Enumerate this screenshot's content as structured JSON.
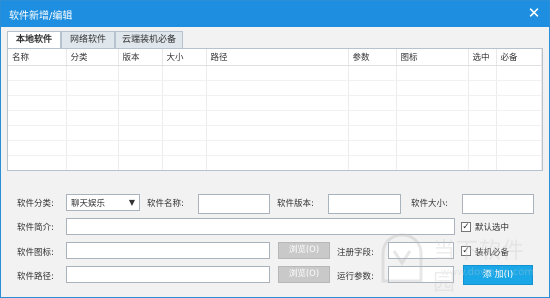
{
  "window": {
    "title": "软件新增/编辑"
  },
  "tabs": [
    {
      "label": "本地软件",
      "active": true
    },
    {
      "label": "网络软件",
      "active": false
    },
    {
      "label": "云端装机必备",
      "active": false
    }
  ],
  "table": {
    "columns": [
      "名称",
      "分类",
      "版本",
      "大小",
      "路径",
      "参数",
      "图标",
      "选中",
      "必备"
    ]
  },
  "form": {
    "category_label": "软件分类:",
    "category_value": "聊天娱乐",
    "name_label": "软件名称:",
    "name_value": "",
    "version_label": "软件版本:",
    "version_value": "",
    "size_label": "软件大小:",
    "size_value": "",
    "intro_label": "软件简介:",
    "intro_value": "",
    "default_selected_label": "默认选中",
    "default_selected_checked": true,
    "icon_label": "软件图标:",
    "icon_value": "",
    "browse1_label": "浏览(O)",
    "regfield_label": "注册字段:",
    "regfield_value": "",
    "essential_label": "装机必备",
    "essential_checked": true,
    "path_label": "软件路径:",
    "path_value": "",
    "browse2_label": "浏览(O)",
    "params_label": "运行参数:",
    "params_value": "",
    "add_button_label": "添 加(I)"
  },
  "watermark": {
    "name": "当下软件园",
    "url": "www.downxia.com"
  },
  "colors": {
    "titlebar": "#1e8fe0",
    "add_button": "#19a7e8",
    "browse_button": "#c9c9c9"
  }
}
